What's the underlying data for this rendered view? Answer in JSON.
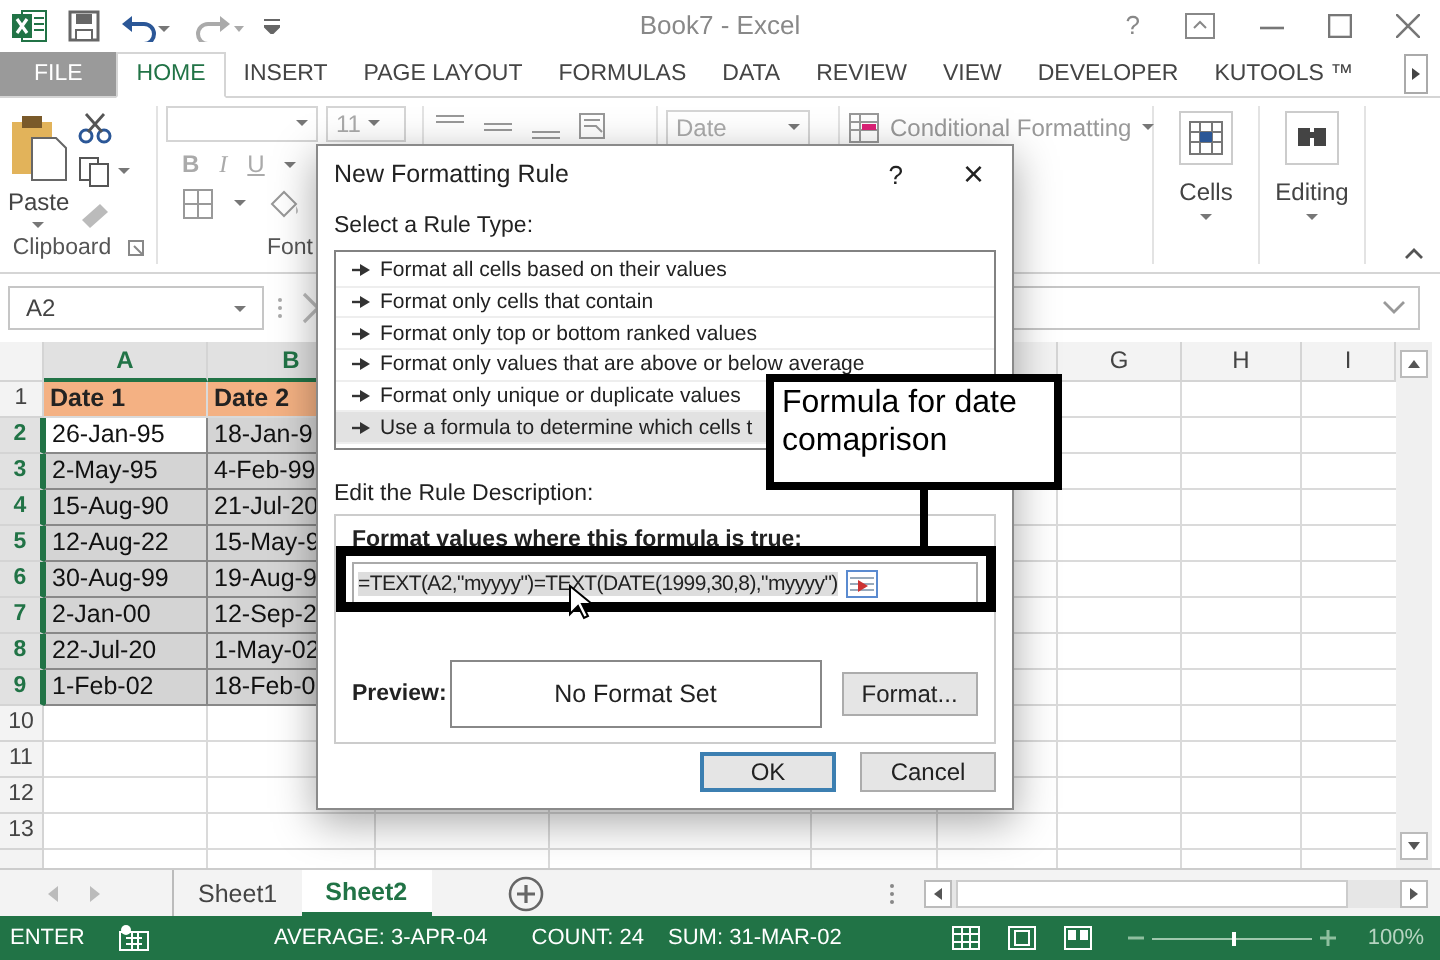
{
  "window": {
    "title": "Book7 - Excel",
    "help": "?"
  },
  "ribbon_tabs": [
    {
      "label": "FILE",
      "kind": "file",
      "selected": false
    },
    {
      "label": "HOME",
      "kind": "tab",
      "selected": true
    },
    {
      "label": "INSERT",
      "kind": "tab",
      "selected": false
    },
    {
      "label": "PAGE LAYOUT",
      "kind": "tab",
      "selected": false
    },
    {
      "label": "FORMULAS",
      "kind": "tab",
      "selected": false
    },
    {
      "label": "DATA",
      "kind": "tab",
      "selected": false
    },
    {
      "label": "REVIEW",
      "kind": "tab",
      "selected": false
    },
    {
      "label": "VIEW",
      "kind": "tab",
      "selected": false
    },
    {
      "label": "DEVELOPER",
      "kind": "tab",
      "selected": false
    },
    {
      "label": "KUTOOLS ™",
      "kind": "tab",
      "selected": false
    }
  ],
  "ribbon": {
    "clipboard": {
      "paste": "Paste",
      "group_label": "Clipboard"
    },
    "font": {
      "size": "11",
      "bold": "B",
      "italic": "I",
      "underline": "U",
      "group_label": "Font"
    },
    "number": {
      "format": "Date"
    },
    "styles": {
      "conditional_formatting": "Conditional Formatting"
    },
    "cells": {
      "label": "Cells"
    },
    "editing": {
      "label": "Editing"
    }
  },
  "formula_bar": {
    "name_box": "A2"
  },
  "sheet": {
    "columns": [
      {
        "label": "A",
        "selected": true
      },
      {
        "label": "B",
        "selected": true
      }
    ],
    "right_columns": [
      {
        "label": "G",
        "selected": false
      },
      {
        "label": "H",
        "selected": false
      },
      {
        "label": "I",
        "selected": false
      }
    ],
    "rows": [
      {
        "label": "1",
        "selected": false,
        "cells": [
          {
            "text": "Date 1",
            "kind": "header"
          },
          {
            "text": "Date 2",
            "kind": "header"
          }
        ]
      },
      {
        "label": "2",
        "selected": true,
        "cells": [
          {
            "text": "26-Jan-95",
            "kind": "active"
          },
          {
            "text": "18-Jan-9",
            "kind": "selected"
          }
        ]
      },
      {
        "label": "3",
        "selected": true,
        "cells": [
          {
            "text": "2-May-95",
            "kind": "selected"
          },
          {
            "text": "4-Feb-99",
            "kind": "selected"
          }
        ]
      },
      {
        "label": "4",
        "selected": true,
        "cells": [
          {
            "text": "15-Aug-90",
            "kind": "selected"
          },
          {
            "text": "21-Jul-20",
            "kind": "selected"
          }
        ]
      },
      {
        "label": "5",
        "selected": true,
        "cells": [
          {
            "text": "12-Aug-22",
            "kind": "selected"
          },
          {
            "text": "15-May-9",
            "kind": "selected"
          }
        ]
      },
      {
        "label": "6",
        "selected": true,
        "cells": [
          {
            "text": "30-Aug-99",
            "kind": "selected"
          },
          {
            "text": "19-Aug-9",
            "kind": "selected"
          }
        ]
      },
      {
        "label": "7",
        "selected": true,
        "cells": [
          {
            "text": "2-Jan-00",
            "kind": "selected"
          },
          {
            "text": "12-Sep-2",
            "kind": "selected"
          }
        ]
      },
      {
        "label": "8",
        "selected": true,
        "cells": [
          {
            "text": "22-Jul-20",
            "kind": "selected"
          },
          {
            "text": "1-May-02",
            "kind": "selected"
          }
        ]
      },
      {
        "label": "9",
        "selected": true,
        "cells": [
          {
            "text": "1-Feb-02",
            "kind": "selected"
          },
          {
            "text": "18-Feb-0",
            "kind": "selected"
          }
        ]
      },
      {
        "label": "10",
        "selected": false
      },
      {
        "label": "11",
        "selected": false
      },
      {
        "label": "12",
        "selected": false
      },
      {
        "label": "13",
        "selected": false
      }
    ]
  },
  "dialog": {
    "title": "New Formatting Rule",
    "help": "?",
    "close": "×",
    "rule_type_label": "Select a Rule Type:",
    "rule_types": [
      {
        "label": "Format all cells based on their values",
        "selected": false
      },
      {
        "label": "Format only cells that contain",
        "selected": false
      },
      {
        "label": "Format only top or bottom ranked values",
        "selected": false
      },
      {
        "label": "Format only values that are above or below average",
        "selected": false
      },
      {
        "label": "Format only unique or duplicate values",
        "selected": false
      },
      {
        "label": "Use a formula to determine which cells t",
        "selected": true
      }
    ],
    "description_label": "Edit the Rule Description:",
    "formula_label": "Format values where this formula is true:",
    "formula": "=TEXT(A2,\"myyyy\")=TEXT(DATE(1999,30,8),\"myyyy\")",
    "preview_label": "Preview:",
    "preview_text": "No Format Set",
    "format_button": "Format...",
    "buttons": [
      {
        "label": "OK",
        "default": true
      },
      {
        "label": "Cancel",
        "default": false
      }
    ]
  },
  "callout": {
    "text": "Formula for date comaprison"
  },
  "sheet_tabs": [
    {
      "label": "Sheet1",
      "selected": false
    },
    {
      "label": "Sheet2",
      "selected": true
    }
  ],
  "status_bar": {
    "mode": "ENTER",
    "average": "AVERAGE: 3-APR-04",
    "count": "COUNT: 24",
    "sum": "SUM: 31-MAR-02",
    "zoom": {
      "level": 0.5,
      "reading": "100%"
    }
  }
}
